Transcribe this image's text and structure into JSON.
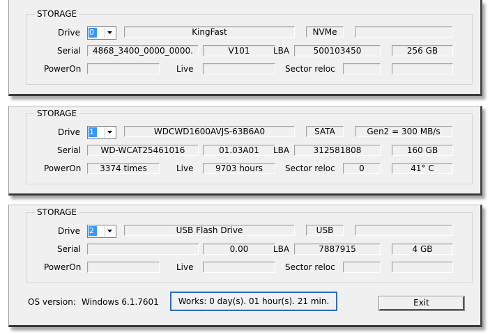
{
  "panels": [
    {
      "group_title": "STORAGE",
      "drive_label": "Drive",
      "drive_index": "0",
      "model": "KingFast",
      "interface": "NVMe",
      "speed": "",
      "serial_label": "Serial",
      "serial": "4868_3400_0000_0000.",
      "firmware": "V101",
      "lba_label": "LBA",
      "lba": "500103450",
      "capacity": "256 GB",
      "poweron_label": "PowerOn",
      "poweron": "",
      "live_label": "Live",
      "live": "",
      "sector_label": "Sector reloc",
      "sector": "",
      "temp": ""
    },
    {
      "group_title": "STORAGE",
      "drive_label": "Drive",
      "drive_index": "1",
      "model": "WDCWD1600AVJS-63B6A0",
      "interface": "SATA",
      "speed": "Gen2 = 300 MB/s",
      "serial_label": "Serial",
      "serial": "WD-WCAT25461016",
      "firmware": "01.03A01",
      "lba_label": "LBA",
      "lba": "312581808",
      "capacity": "160 GB",
      "poweron_label": "PowerOn",
      "poweron": "3374  times",
      "live_label": "Live",
      "live": "9703  hours",
      "sector_label": "Sector reloc",
      "sector": "0",
      "temp": "41° C"
    },
    {
      "group_title": "STORAGE",
      "drive_label": "Drive",
      "drive_index": "2",
      "model": "USB Flash Drive",
      "interface": "USB",
      "speed": "",
      "serial_label": "Serial",
      "serial": "",
      "firmware": "0.00",
      "lba_label": "LBA",
      "lba": "7887915",
      "capacity": "4 GB",
      "poweron_label": "PowerOn",
      "poweron": "",
      "live_label": "Live",
      "live": "",
      "sector_label": "Sector reloc",
      "sector": "",
      "temp": ""
    }
  ],
  "footer": {
    "os_label": "OS version:",
    "os_value": "Windows 6.1.7601",
    "works": "Works:  0 day(s). 01 hour(s). 21 min.",
    "exit_label": "Exit"
  },
  "colors": {
    "panel_bg": "#f0f0f0",
    "selection": "#3399ff",
    "works_border": "#2d6ab8"
  }
}
